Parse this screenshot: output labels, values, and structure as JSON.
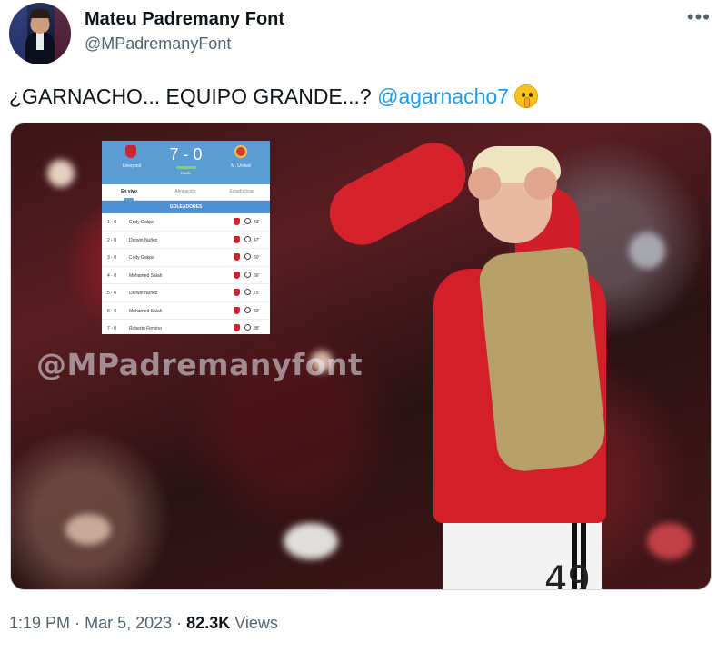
{
  "author": {
    "name": "Mateu Padremany Font",
    "handle": "@MPadremanyFont"
  },
  "menu_icon": "more-horizontal-icon",
  "tweet": {
    "text": "¿GARNACHO... EQUIPO GRANDE...? ",
    "mention": "@agarnacho7",
    "emoji": "shushing-face-emoji"
  },
  "media": {
    "watermark": "@MPadremanyfont",
    "jersey_number": "49",
    "scorecard": {
      "home_team": "Liverpool",
      "away_team": "M. United",
      "score": "7 - 0",
      "broadcaster": "DAZN",
      "tabs": [
        "En vivo",
        "Alineación",
        "Estadísticas"
      ],
      "section_title": "GOLEADORES",
      "goals": [
        {
          "result": "1 - 0",
          "player": "Cody Gakpo",
          "minute": "43'"
        },
        {
          "result": "2 - 0",
          "player": "Darwin Nuñez",
          "minute": "47'"
        },
        {
          "result": "3 - 0",
          "player": "Cody Gakpo",
          "minute": "50'"
        },
        {
          "result": "4 - 0",
          "player": "Mohamed Salah",
          "minute": "66'"
        },
        {
          "result": "5 - 0",
          "player": "Darwin Nuñez",
          "minute": "75'"
        },
        {
          "result": "6 - 0",
          "player": "Mohamed Salah",
          "minute": "83'"
        },
        {
          "result": "7 - 0",
          "player": "Roberto Firmino",
          "minute": "88'"
        }
      ]
    }
  },
  "footer": {
    "time": "1:19 PM",
    "separator": "·",
    "date": "Mar 5, 2023",
    "views_count": "82.3K",
    "views_label": "Views"
  }
}
